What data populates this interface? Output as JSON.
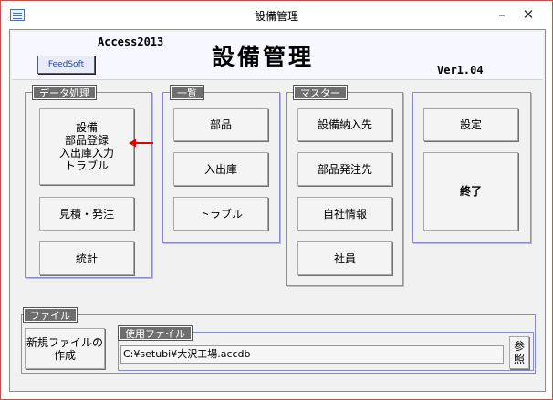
{
  "window": {
    "title": "設備管理",
    "minimize_label": "–",
    "close_label": "✕"
  },
  "header": {
    "access_label": "Access2013",
    "feedsoft_label": "FeedSoft",
    "main_title": "設備管理",
    "version": "Ver1.04"
  },
  "groups": {
    "data": {
      "label": "データ処理",
      "main_button_lines": [
        "設備",
        "部品登録",
        "入出庫入力",
        "トラブル"
      ],
      "estimate": "見積・発注",
      "stats": "統計"
    },
    "list": {
      "label": "一覧",
      "parts": "部品",
      "inout": "入出庫",
      "trouble": "トラブル"
    },
    "master": {
      "label": "マスター",
      "supplier": "設備納入先",
      "parts_order": "部品発注先",
      "company": "自社情報",
      "employee": "社員"
    },
    "misc": {
      "settings": "設定",
      "exit": "終了"
    }
  },
  "file": {
    "label": "ファイル",
    "new_lines": [
      "新規ファイルの",
      "作成"
    ],
    "use_label": "使用ファイル",
    "path": "C:¥setubi¥大沢工場.accdb",
    "browse_lines": [
      "参",
      "照"
    ]
  },
  "colors": {
    "arrow": "#e00000",
    "group_border": "#8a8ad0",
    "label_bg": "#6e6e6e"
  },
  "icons": {
    "app": "form-icon",
    "arrow": "left-arrow-icon"
  }
}
